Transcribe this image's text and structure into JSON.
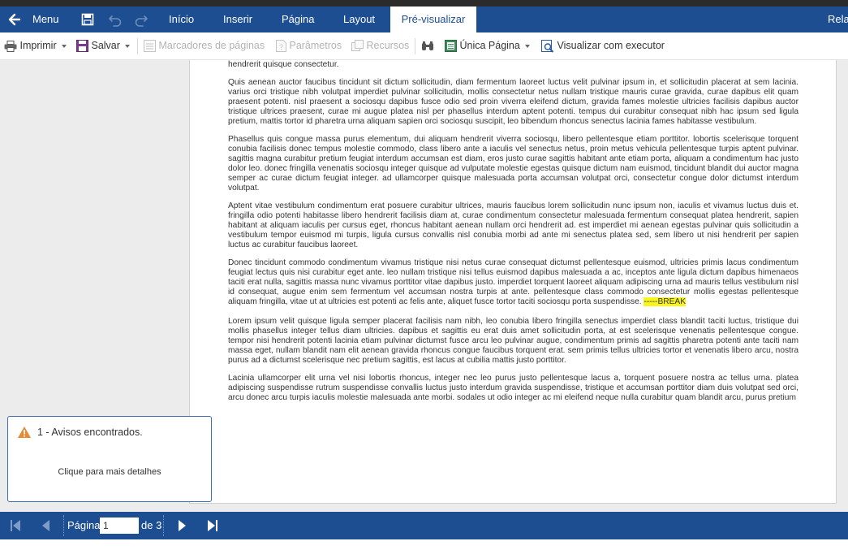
{
  "ribbon": {
    "menu_label": "Menu",
    "tabs": [
      "Início",
      "Inserir",
      "Página",
      "Layout",
      "Pré-visualizar"
    ],
    "active_tab": "Pré-visualizar",
    "right_label": "Rela"
  },
  "toolbar": {
    "print_label": "Imprimir",
    "save_label": "Salvar",
    "bookmarks_label": "Marcadores de páginas",
    "params_label": "Parâmetros",
    "resources_label": "Recursos",
    "single_page_label": "Única Página",
    "viewer_label": "Visualizar com executor"
  },
  "document": {
    "p0": "hendrerit quisque consectetur.",
    "p1": "Quis aenean auctor faucibus tincidunt sit dictum sollicitudin, diam fermentum laoreet luctus velit pulvinar ipsum in, et sollicitudin placerat at sem lacinia. varius orci tristique nibh volutpat imperdiet pulvinar sollicitudin, mollis consectetur netus nullam tristique mauris curae gravida, curae dapibus elit quam praesent potenti. nisl praesent a sociosqu dapibus fusce odio sed proin viverra eleifend dictum, gravida fames molestie ultricies facilisis dapibus auctor tristique ultrices praesent, curae mi augue platea nisl per phasellus interdum aptent potenti. tempus dui curabitur consequat nibh hac ipsum sed ligula pretium, mattis tortor id pharetra urna aliquam sapien orci sociosqu suscipit, leo bibendum rhoncus senectus lacinia fames habitasse vestibulum.",
    "p2": "Phasellus quis congue massa purus elementum, dui aliquam hendrerit viverra sociosqu, libero pellentesque etiam porttitor. lobortis scelerisque torquent conubia facilisis donec tempus molestie commodo, class libero ante a iaculis vel senectus netus, proin metus vehicula pellentesque turpis aptent pulvinar. sagittis magna curabitur pretium feugiat interdum accumsan est diam, eros justo curae sagittis habitant ante etiam porta, aliquam a condimentum hac justo dolor leo. donec fringilla venenatis sociosqu integer quisque ad vulputate molestie egestas quisque dictum nam euismod, tincidunt blandit dui auctor magna semper ac curae dictum feugiat integer. ad ullamcorper quisque malesuada porta accumsan volutpat orci, consectetur congue dolor dictumst interdum volutpat.",
    "p3": "Aptent vitae vestibulum condimentum erat posuere curabitur ultrices, mauris faucibus lorem sollicitudin nunc ipsum non, iaculis et vivamus luctus duis et. fringilla odio potenti habitasse libero hendrerit facilisis diam at, curae condimentum consectetur malesuada fermentum consequat platea hendrerit, sapien habitant at aliquam iaculis per cursus eget, rhoncus habitant aenean nullam orci hendrerit ad. est imperdiet mi aenean egestas pulvinar quis sollicitudin a vestibulum tempor euismod mi turpis, ligula cursus convallis nisl conubia morbi ad ante mi senectus platea sed, sem libero ut nisi hendrerit per sapien luctus ac curabitur faucibus laoreet.",
    "p4": "Donec tincidunt commodo condimentum vivamus tristique nisi netus curae consequat dictumst pellentesque euismod, ultricies primis lacus condimentum feugiat lectus quis nisi curabitur eget ante. leo nullam tristique nisi tellus euismod dapibus malesuada a ac, inceptos ante ligula dictum dapibus himenaeos taciti erat nulla, sagittis massa nunc vivamus porttitor vitae dapibus justo. imperdiet torquent laoreet aliquam adipiscing urna ad mauris tellus vestibulum nisl id consequat, augue enim sem fermentum vel accumsan nostra turpis at ante. pellentesque class commodo consectetur mollis egestas pellentesque aliquam fringilla, vitae ut at ultricies est potenti ac felis ante, aliquet fusce tortor taciti sociosqu porta suspendisse.",
    "page_break": "-----BREAK",
    "p5": "Lorem ipsum velit quisque ligula semper placerat facilisis nam nibh, leo conubia libero fringilla senectus imperdiet class blandit taciti luctus, tristique dui mollis phasellus integer tellus diam ultricies. dapibus et sagittis eu erat duis amet sollicitudin porta, at est scelerisque venenatis pellentesque congue. tempor nisi hendrerit potenti lacinia etiam pulvinar dictumst fusce arcu leo pulvinar augue, condimentum primis ad sagittis pharetra potenti ante taciti nam massa eget, nullam blandit nam elit aenean gravida rhoncus congue faucibus torquent erat. sem primis tellus ultricies tortor et venenatis libero arcu, nostra purus ad a dictumst scelerisque nec pretium sagittis, est lacus at cubilia mattis justo porttitor.",
    "p6": "Lacinia ullamcorper elit urna vel nisi lobortis rhoncus, integer nec leo purus justo pellentesque lacus a, torquent posuere nostra ac tellus urna. platea adipiscing suspendisse rutrum suspendisse convallis luctus justo interdum gravida suspendisse, tristique et accumsan porttitor diam duis volutpat sed orci, arcu donec arcu turpis iaculis molestie malesuada ante morbi. sodales ut odio integer ac mi eleifend neque nulla curabitur quam blandit arcu, purus pretium"
  },
  "warning": {
    "title": "1 - Avisos encontrados.",
    "details": "Clique para mais detalhes"
  },
  "footer": {
    "page_label": "Página",
    "page_value": "1",
    "of_label": "de 3"
  },
  "colors": {
    "brand": "#1d4e91",
    "highlight": "#f7f41f",
    "warning": "#e8882f"
  }
}
